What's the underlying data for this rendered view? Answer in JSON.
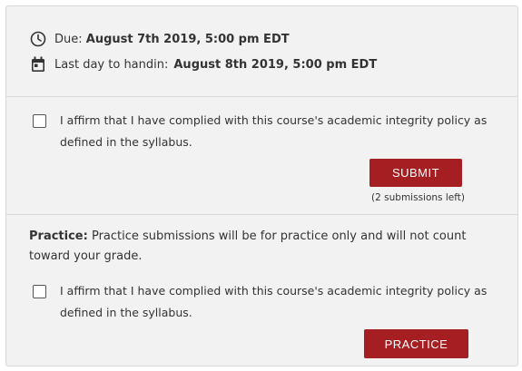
{
  "due": {
    "label": "Due:",
    "date": "August 7th 2019, 5:00 pm EDT"
  },
  "handin": {
    "label": "Last day to handin:",
    "date": "August 8th 2019, 5:00 pm EDT"
  },
  "submit_section": {
    "affirm_text": "I affirm that I have complied with this course's academic integrity policy as defined in the syllabus.",
    "button_label": "SUBMIT",
    "submissions_left": "(2 submissions left)"
  },
  "practice_section": {
    "title": "Practice:",
    "note": "Practice submissions will be for practice only and will not count toward your grade.",
    "affirm_text": "I affirm that I have complied with this course's academic integrity policy as defined in the syllabus.",
    "button_label": "PRACTICE"
  },
  "icons": {
    "due": "clock-icon",
    "handin": "calendar-icon"
  },
  "colors": {
    "button": "#a51e22",
    "panel": "#f2f2f2"
  }
}
